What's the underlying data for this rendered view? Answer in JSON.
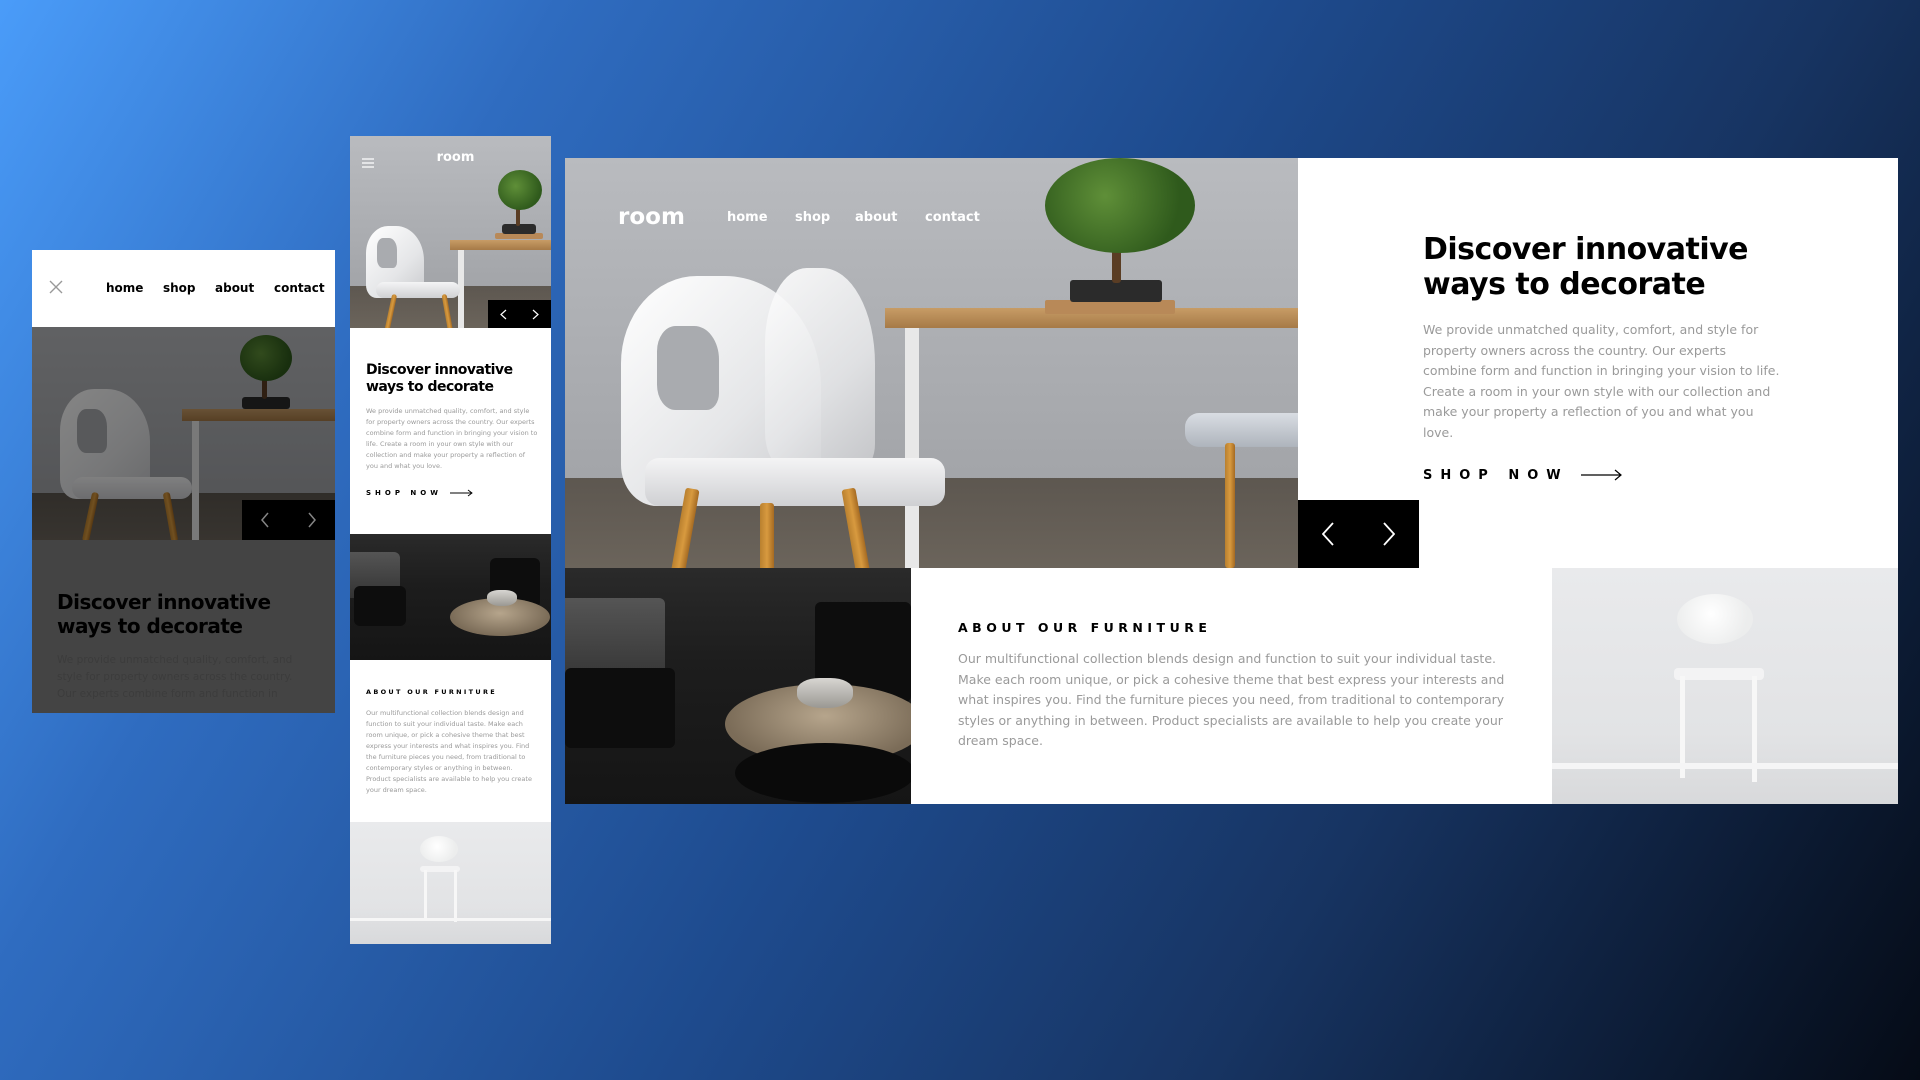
{
  "brand": "room",
  "nav": {
    "home": "home",
    "shop": "shop",
    "about": "about",
    "contact": "contact"
  },
  "hero": {
    "title": "Discover innovative ways to decorate",
    "body": "We provide unmatched quality, comfort, and style for property owners across the country. Our experts combine form and function in bringing your vision to life. Create a room in your own style with our collection and make your property a reflection of you and what you love.",
    "cta": "SHOP NOW",
    "mobile_menu_body_fragment": "We provide unmatched quality, comfort, and style for property owners across the country. Our experts combine form and function in"
  },
  "about": {
    "title": "ABOUT OUR FURNITURE",
    "body": "Our multifunctional collection blends design and function to suit your individual taste. Make each room unique, or pick a cohesive theme that best express your interests and what inspires you. Find the furniture pieces you need, from traditional to contemporary styles or anything in between. Product specialists are available to help you create your dream space."
  },
  "icons": {
    "menu": "hamburger-icon",
    "close": "close-icon",
    "prev": "chevron-left-icon",
    "next": "chevron-right-icon",
    "cta_arrow": "arrow-right-icon"
  },
  "colors": {
    "background_start": "#4a9cf9",
    "background_end": "#050b16",
    "text_primary": "#000000",
    "text_muted": "#9a9a9a",
    "control_bg": "#000000"
  }
}
